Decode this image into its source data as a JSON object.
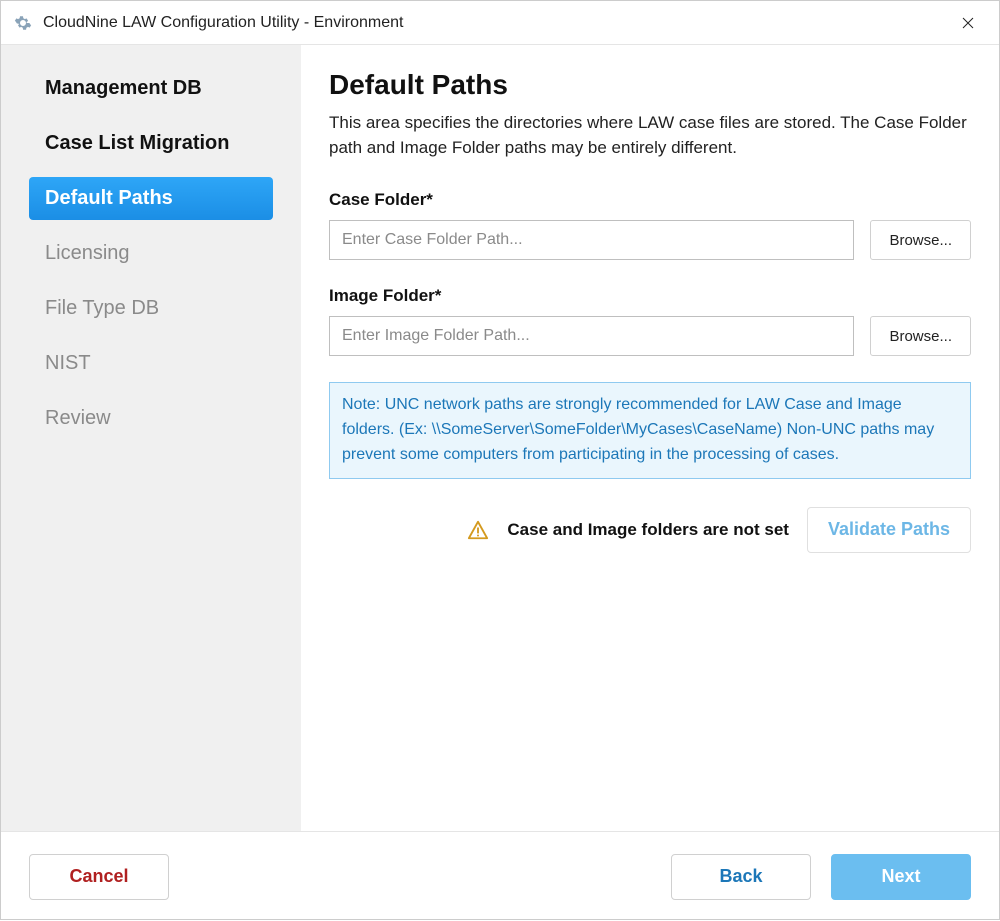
{
  "window": {
    "title": "CloudNine LAW Configuration Utility - Environment"
  },
  "sidebar": {
    "items": [
      {
        "label": "Management DB",
        "state": "done"
      },
      {
        "label": "Case List Migration",
        "state": "done"
      },
      {
        "label": "Default Paths",
        "state": "active"
      },
      {
        "label": "Licensing",
        "state": "pending"
      },
      {
        "label": "File Type DB",
        "state": "pending"
      },
      {
        "label": "NIST",
        "state": "pending"
      },
      {
        "label": "Review",
        "state": "pending"
      }
    ]
  },
  "main": {
    "title": "Default Paths",
    "description": "This area specifies the directories where LAW case files are stored. The Case Folder path and Image Folder paths may be entirely different.",
    "case_folder": {
      "label": "Case Folder*",
      "placeholder": "Enter Case Folder Path...",
      "value": "",
      "browse": "Browse..."
    },
    "image_folder": {
      "label": "Image Folder*",
      "placeholder": "Enter Image Folder Path...",
      "value": "",
      "browse": "Browse..."
    },
    "note": "Note: UNC network paths are strongly recommended for LAW Case and Image folders. (Ex: \\\\SomeServer\\SomeFolder\\MyCases\\CaseName) Non-UNC paths may prevent some computers from participating in the processing of cases.",
    "warning_text": "Case and Image folders are not set",
    "validate_label": "Validate Paths"
  },
  "footer": {
    "cancel": "Cancel",
    "back": "Back",
    "next": "Next"
  }
}
